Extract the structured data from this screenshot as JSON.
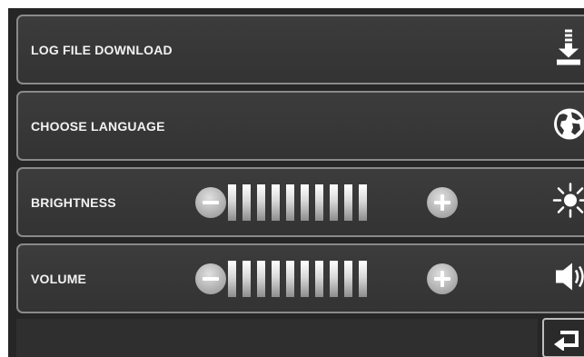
{
  "menu": {
    "log_download": {
      "label": "LOG FILE DOWNLOAD",
      "icon": "download-icon"
    },
    "language": {
      "label": "CHOOSE LANGUAGE",
      "icon": "globe-icon"
    },
    "brightness": {
      "label": "BRIGHTNESS",
      "icon": "sun-icon",
      "level_segments": 10,
      "decrease_icon": "minus-icon",
      "increase_icon": "plus-icon"
    },
    "volume": {
      "label": "VOLUME",
      "icon": "speaker-icon",
      "level_segments": 10,
      "decrease_icon": "minus-icon",
      "increase_icon": "plus-icon"
    }
  },
  "footer": {
    "back_icon": "return-icon"
  },
  "colors": {
    "background": "#262626",
    "row_border": "#8a8a8a",
    "text": "#f2f2f2"
  }
}
